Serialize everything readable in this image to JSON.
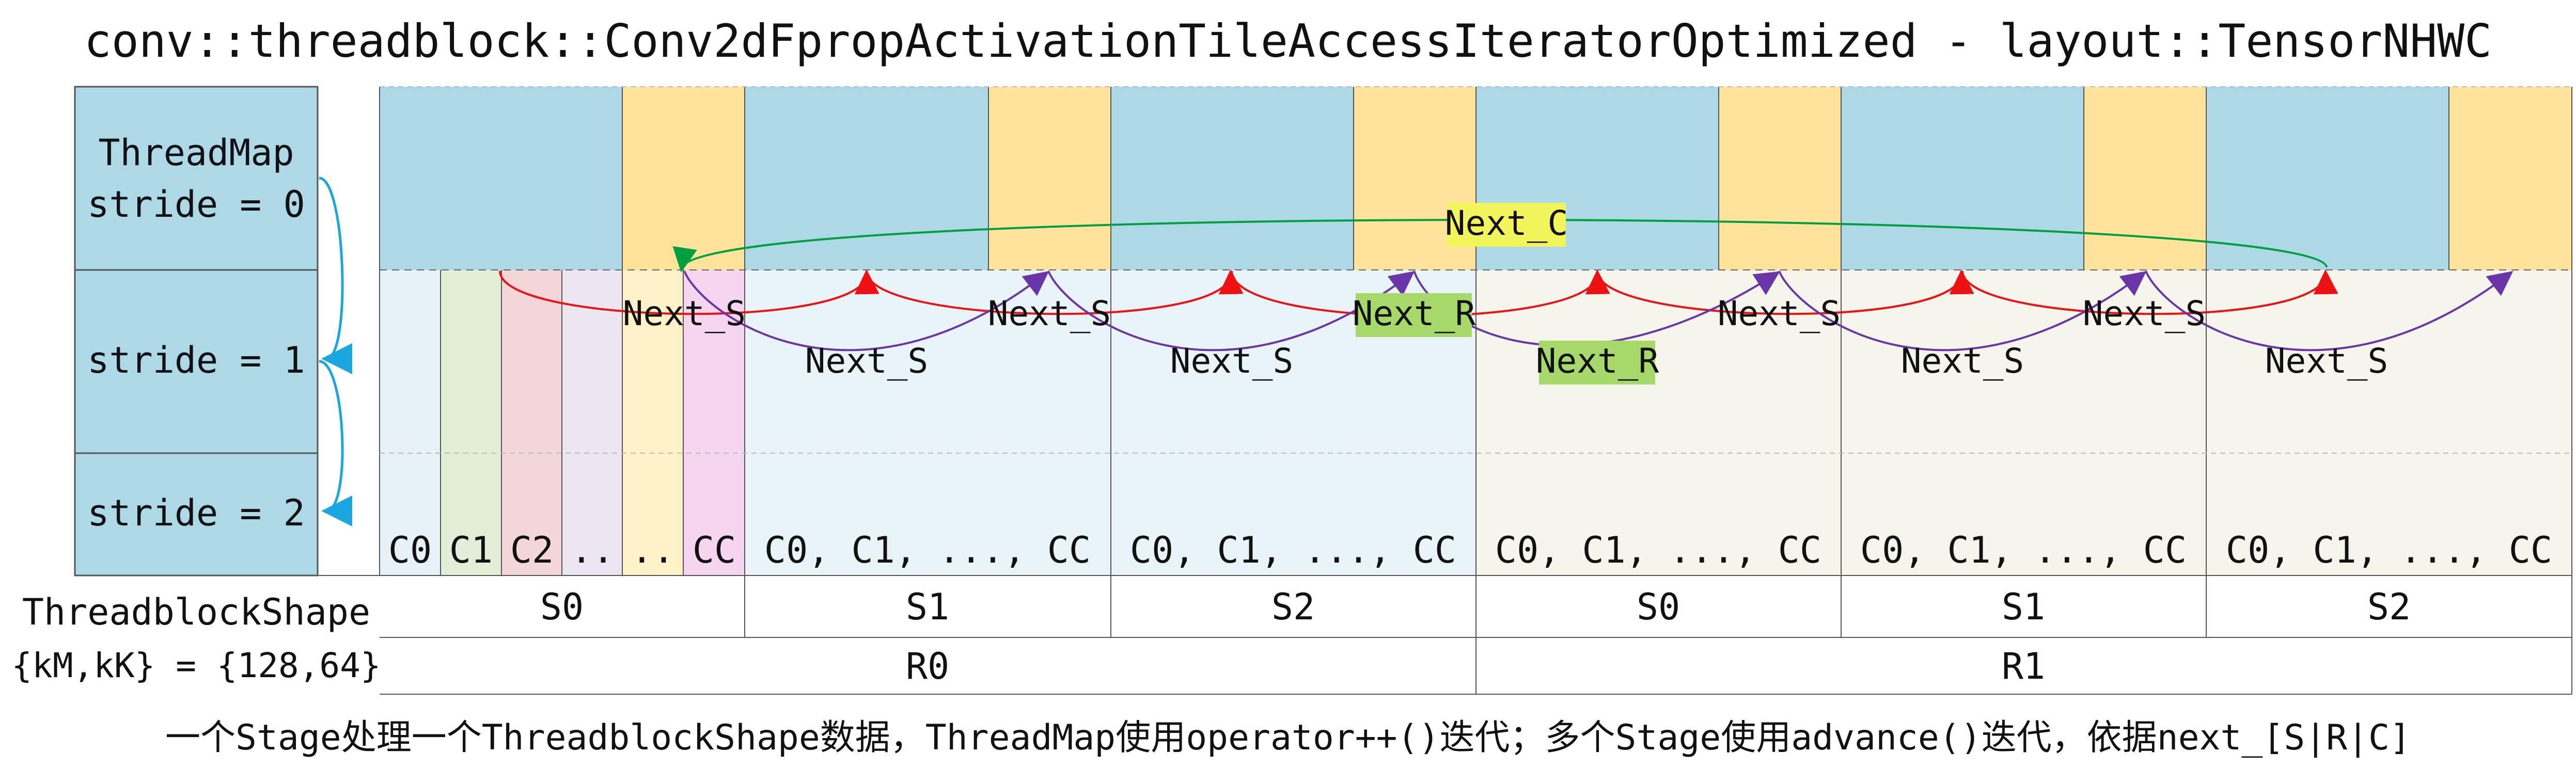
{
  "title": "conv::threadblock::Conv2dFpropActivationTileAccessIteratorOptimized - layout::TensorNHWC",
  "thread_map": {
    "line1": "ThreadMap",
    "line2": "stride = 0",
    "stride1": "stride = 1",
    "stride2": "stride = 2"
  },
  "threadblock_shape": {
    "line1": "ThreadblockShape",
    "line2": "{kM,kK} = {128,64}"
  },
  "channels_first": [
    "C0",
    "C1",
    "C2",
    "..",
    "..",
    "CC"
  ],
  "channels_group": "C0, C1, ..., CC",
  "s_labels": [
    "S0",
    "S1",
    "S2",
    "S0",
    "S1",
    "S2"
  ],
  "r_labels": [
    "R0",
    "R1"
  ],
  "arrow_labels": {
    "next_c": "Next_C",
    "next_s": "Next_S",
    "next_r": "Next_R"
  },
  "caption": "一个Stage处理一个ThreadblockShape数据，ThreadMap使用operator++()迭代；多个Stage使用advance()迭代，依据next_[S|R|C]",
  "colors": {
    "tile_blue": "#add8e6",
    "tile_yellow": "#ffe39b",
    "panel_left": "#e9f4f8",
    "panel_right": "#f5f5ec",
    "next_c_highlight": "#f2f55a",
    "next_r_highlight": "#a6d96a",
    "arrow_red": "#ee1111",
    "arrow_purple": "#6a35a8",
    "arrow_green": "#00a040",
    "arrow_cyan": "#1aa7e0"
  }
}
